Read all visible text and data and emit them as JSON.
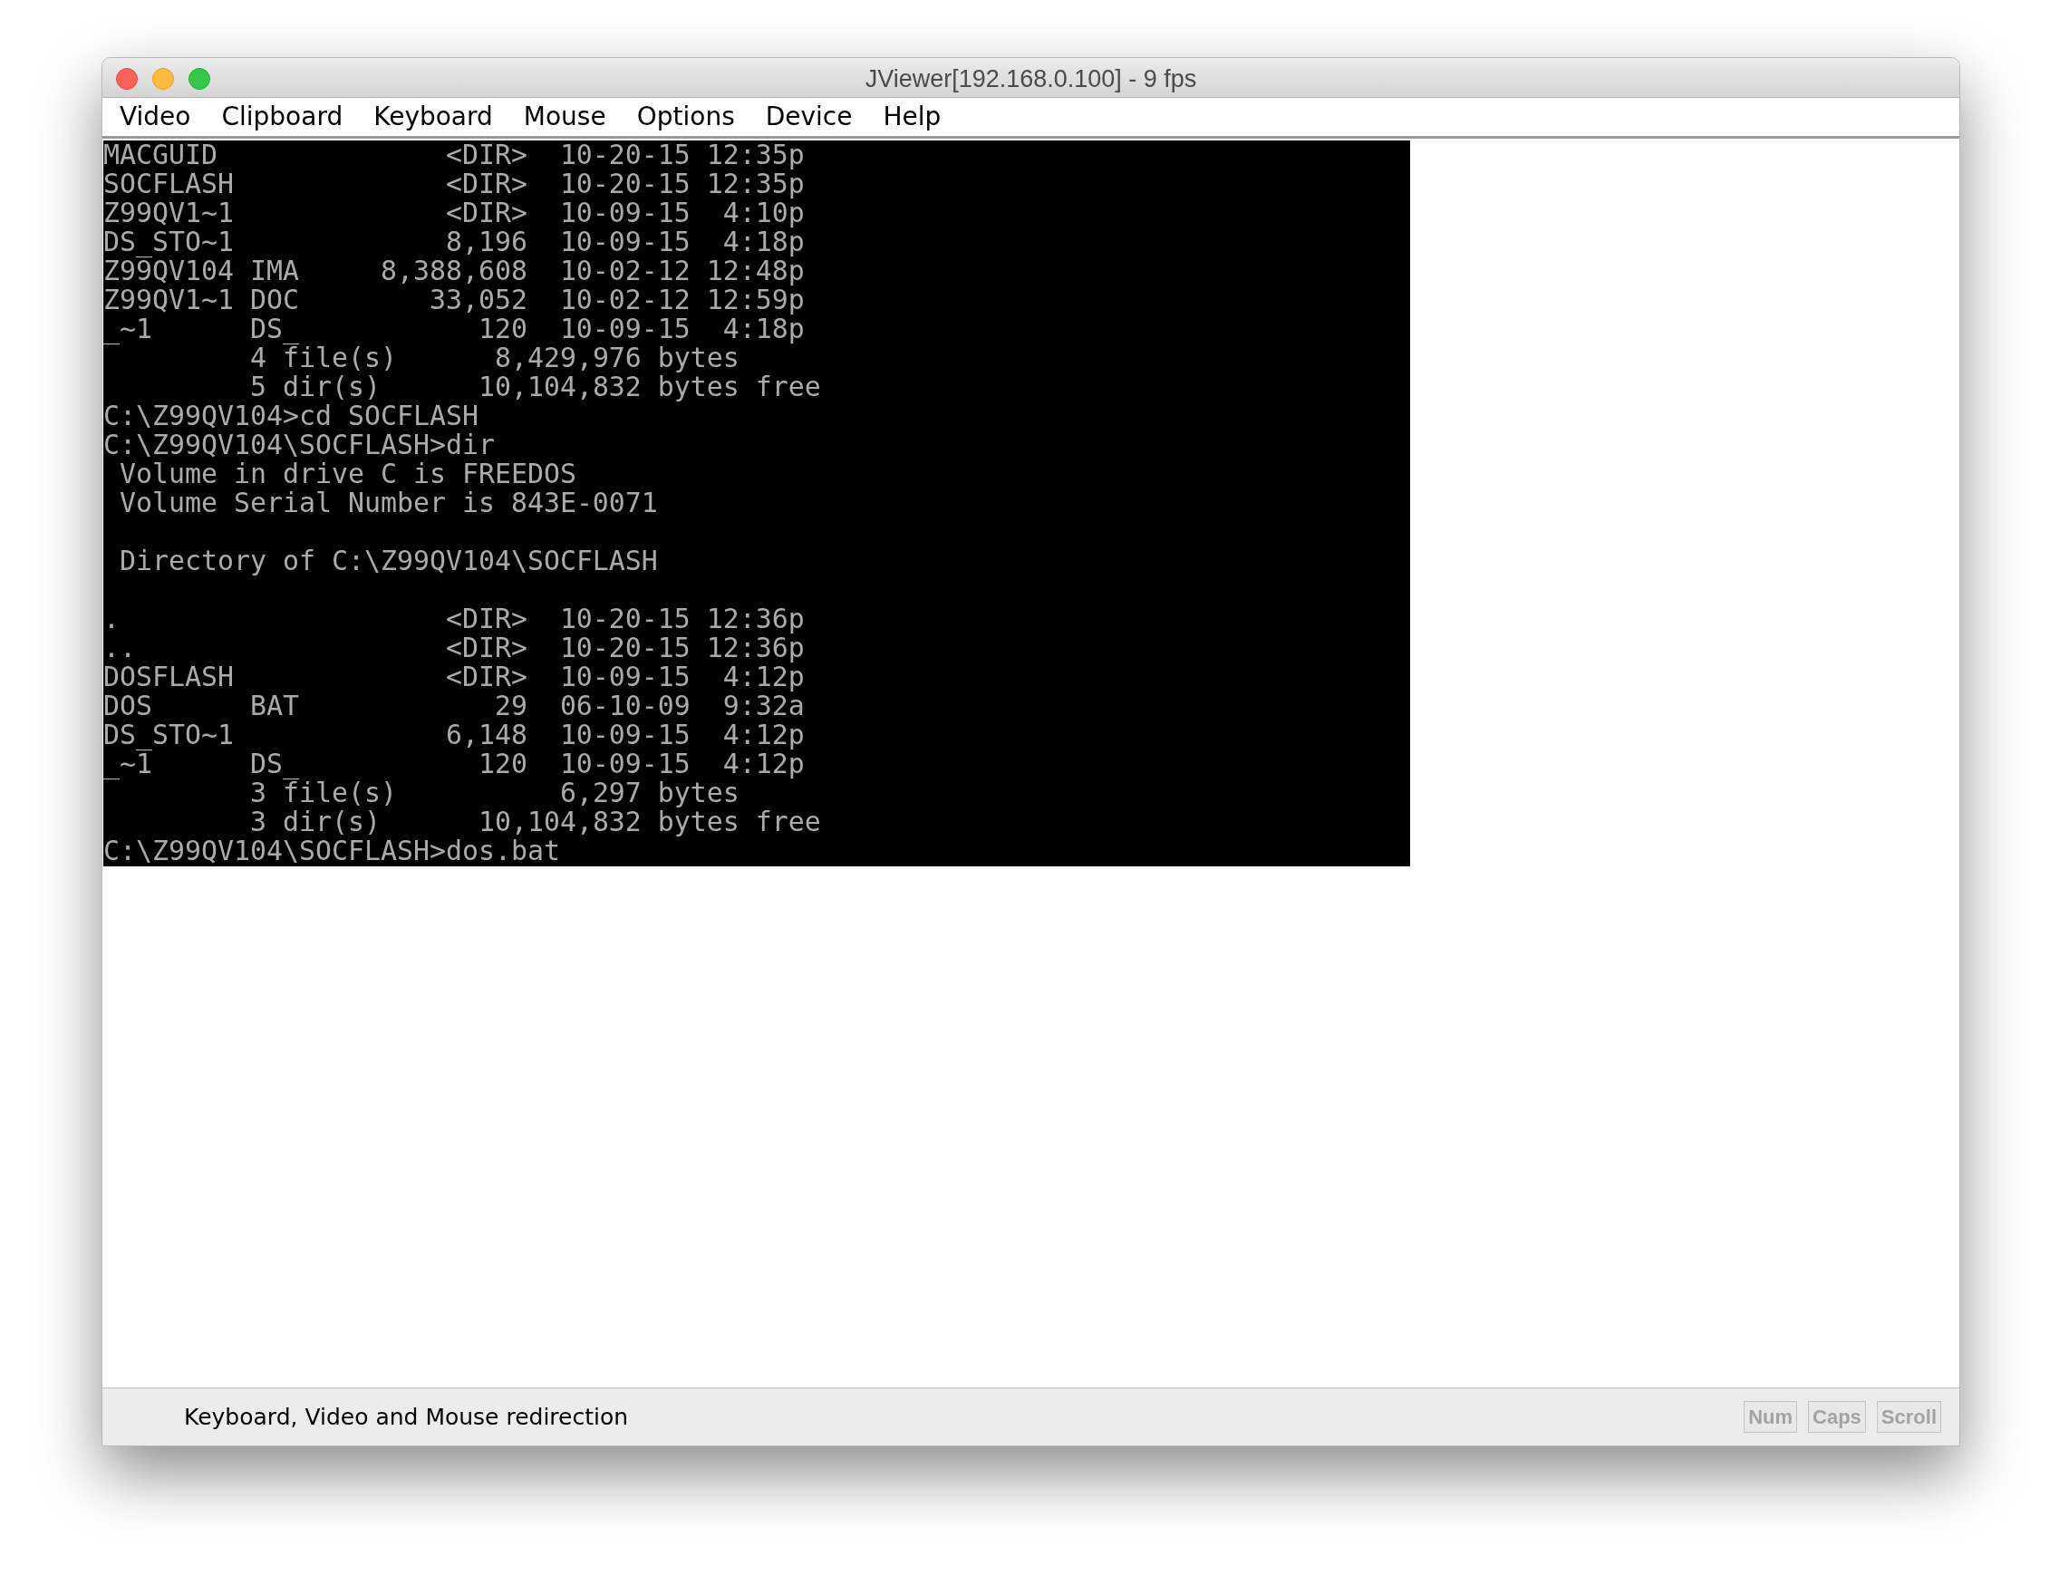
{
  "window": {
    "title": "JViewer[192.168.0.100] - 9 fps"
  },
  "menu": [
    "Video",
    "Clipboard",
    "Keyboard",
    "Mouse",
    "Options",
    "Device",
    "Help"
  ],
  "terminal": {
    "blocks": [
      [
        "MACGUID              <DIR>  10-20-15 12:35p",
        "SOCFLASH             <DIR>  10-20-15 12:35p",
        "Z99QV1~1             <DIR>  10-09-15  4:10p",
        "DS_STO~1             8,196  10-09-15  4:18p",
        "Z99QV104 IMA     8,388,608  10-02-12 12:48p",
        "Z99QV1~1 DOC        33,052  10-02-12 12:59p",
        "_~1      DS_           120  10-09-15  4:18p",
        "         4 file(s)      8,429,976 bytes",
        "         5 dir(s)      10,104,832 bytes free",
        "C:\\Z99QV104>cd SOCFLASH",
        "C:\\Z99QV104\\SOCFLASH>dir",
        " Volume in drive C is FREEDOS",
        " Volume Serial Number is 843E-0071"
      ],
      [
        " Directory of C:\\Z99QV104\\SOCFLASH"
      ],
      [
        ".                    <DIR>  10-20-15 12:36p",
        "..                   <DIR>  10-20-15 12:36p",
        "DOSFLASH             <DIR>  10-09-15  4:12p",
        "DOS      BAT            29  06-10-09  9:32a",
        "DS_STO~1             6,148  10-09-15  4:12p",
        "_~1      DS_           120  10-09-15  4:12p",
        "         3 file(s)          6,297 bytes",
        "         3 dir(s)      10,104,832 bytes free",
        "C:\\Z99QV104\\SOCFLASH>dos.bat"
      ]
    ]
  },
  "status_bar": {
    "message": "Keyboard, Video and Mouse redirection",
    "indicators": [
      {
        "label": "Num",
        "on": false
      },
      {
        "label": "Caps",
        "on": false
      },
      {
        "label": "Scroll",
        "on": false
      }
    ]
  }
}
